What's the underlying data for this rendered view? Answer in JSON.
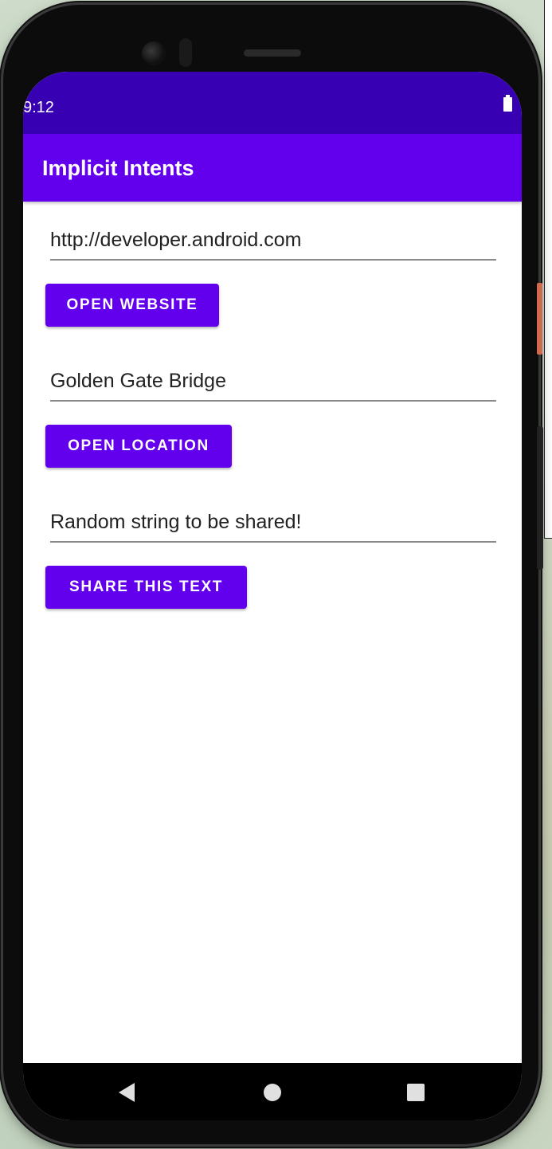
{
  "status_bar": {
    "time": "9:12",
    "battery_icon": "battery-full-icon"
  },
  "app_bar": {
    "title": "Implicit Intents"
  },
  "main": {
    "website_field": {
      "value": "http://developer.android.com"
    },
    "website_button": {
      "label": "OPEN WEBSITE"
    },
    "location_field": {
      "value": "Golden Gate Bridge"
    },
    "location_button": {
      "label": "OPEN LOCATION"
    },
    "share_field": {
      "value": "Random string to be shared!"
    },
    "share_button": {
      "label": "SHARE THIS TEXT"
    }
  },
  "nav_bar": {
    "icons": [
      "back-icon",
      "home-icon",
      "recents-icon"
    ]
  },
  "colors": {
    "primary": "#6200ee",
    "primary_dark": "#3700b3",
    "on_primary": "#ffffff",
    "background": "#ffffff"
  }
}
